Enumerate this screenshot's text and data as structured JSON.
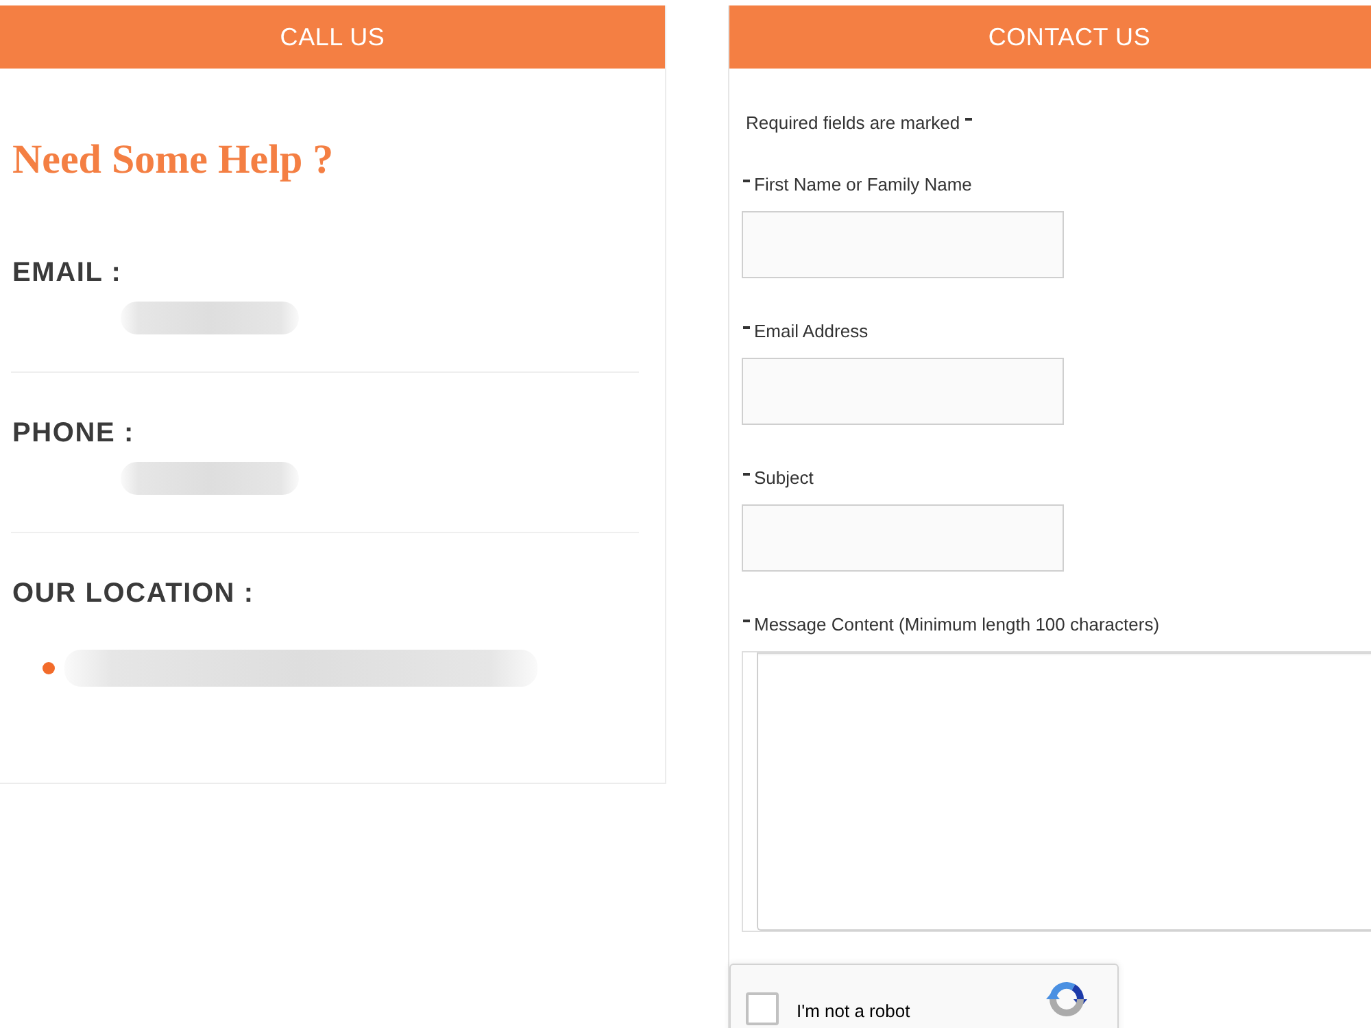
{
  "call_panel": {
    "header": "CALL US",
    "heading": "Need Some Help ?",
    "items": [
      {
        "label": "EMAIL :",
        "kind": "plain"
      },
      {
        "label": "PHONE :",
        "kind": "plain"
      },
      {
        "label": "OUR LOCATION :",
        "kind": "bullet"
      }
    ]
  },
  "contact_panel": {
    "header": "CONTACT US",
    "required_note": {
      "text": "Required fields are marked",
      "marked": true
    },
    "fields": [
      {
        "label": "First Name or Family Name",
        "required": true,
        "kind": "input"
      },
      {
        "label": "Email Address",
        "required": true,
        "kind": "input"
      },
      {
        "label": "Subject",
        "required": true,
        "kind": "input"
      },
      {
        "label": "Message Content (Minimum length 100 characters)",
        "required": true,
        "kind": "textarea"
      }
    ],
    "captcha": {
      "label": "I'm not a robot",
      "checked": false
    }
  }
}
